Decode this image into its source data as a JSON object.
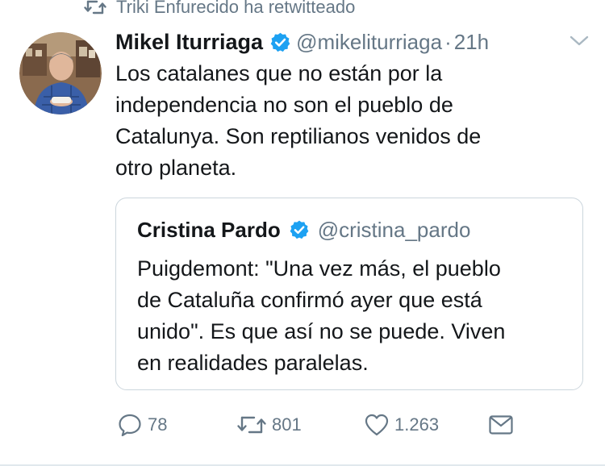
{
  "retweet": {
    "icon": "retweet-icon",
    "text": "Triki Enfurecido ha retwitteado"
  },
  "tweet": {
    "author_name": "Mikel Iturriaga",
    "verified_icon": "verified-badge-icon",
    "handle": "@mikeliturriaga",
    "separator": "·",
    "time": "21h",
    "menu_icon": "chevron-down-icon",
    "avatar": "profile-photo",
    "text_lines": [
      "Los catalanes que no están por la",
      "independencia no son el pueblo de",
      "Catalunya. Son reptilianos venidos de",
      "otro planeta."
    ]
  },
  "quoted_tweet": {
    "author_name": "Cristina Pardo",
    "verified_icon": "verified-badge-icon",
    "handle": "@cristina_pardo",
    "text_lines": [
      "Puigdemont: \"Una vez más, el pueblo",
      "de Cataluña confirmó ayer que está",
      "unido\". Es que así no se puede. Viven",
      "en realidades paralelas."
    ]
  },
  "actions": {
    "reply": {
      "icon": "reply-icon",
      "count": "78"
    },
    "retweet": {
      "icon": "retweet-icon",
      "count": "801"
    },
    "like": {
      "icon": "heart-icon",
      "count": "1.263"
    },
    "message": {
      "icon": "envelope-icon"
    }
  },
  "colors": {
    "text": "#14171a",
    "secondary": "#657786",
    "verified": "#1da1f2",
    "border": "#ccd6dd"
  }
}
